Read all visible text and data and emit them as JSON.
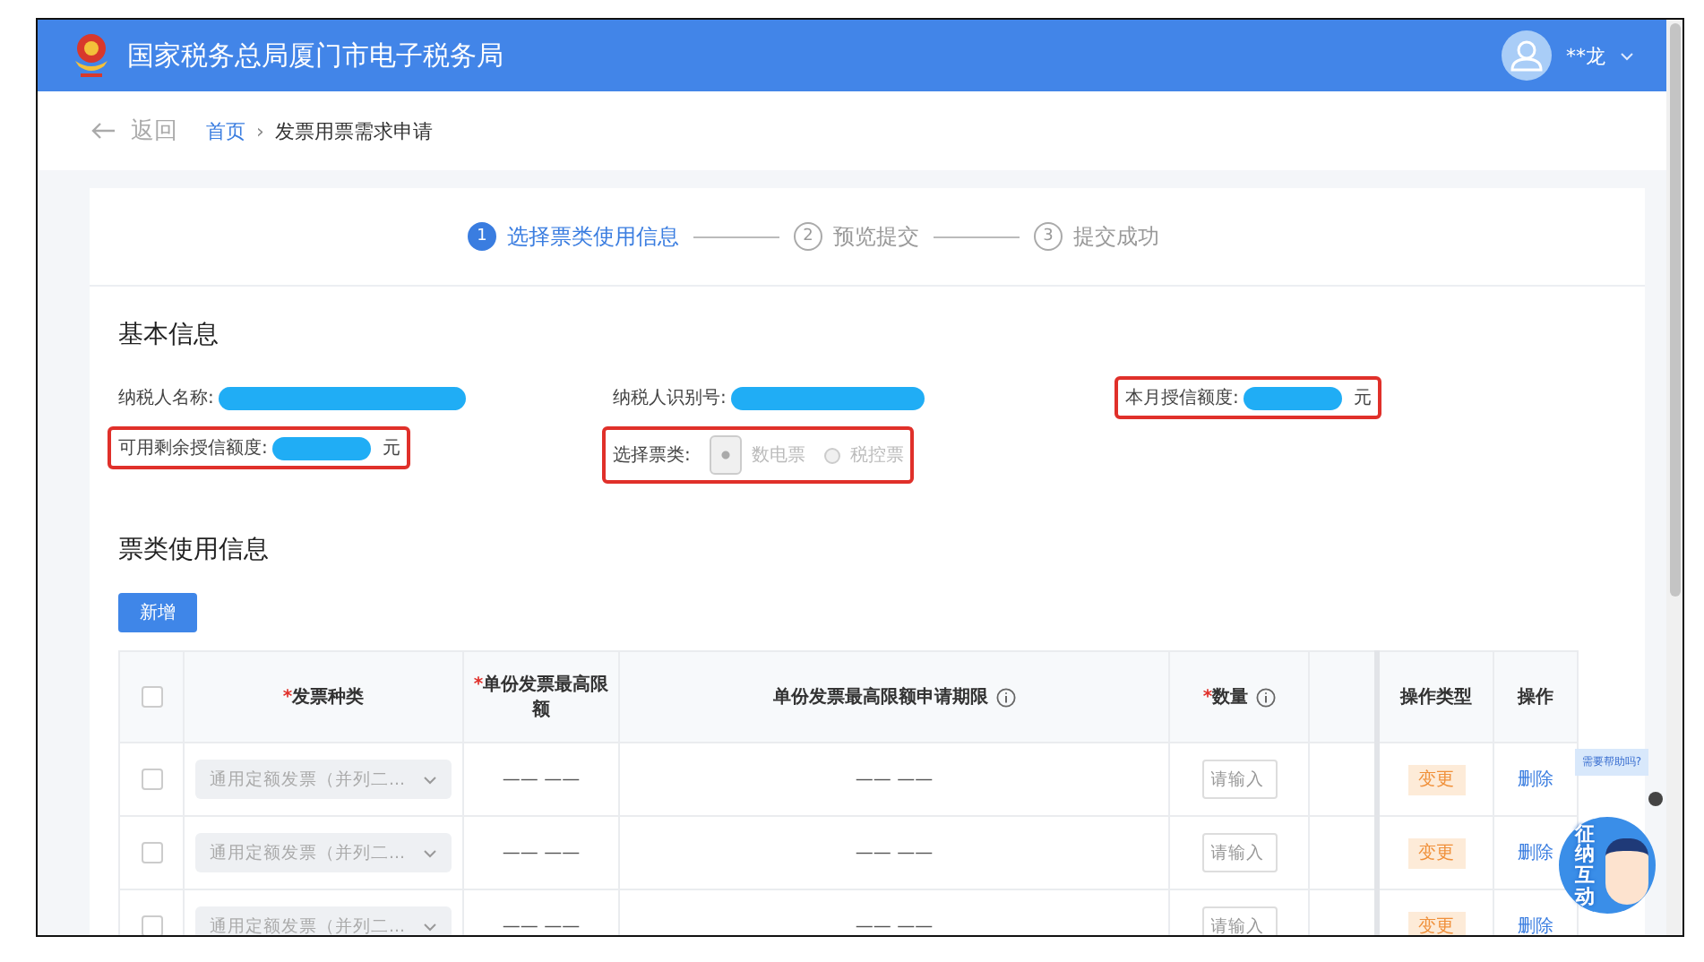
{
  "header": {
    "title": "国家税务总局厦门市电子税务局",
    "user_name": "**龙"
  },
  "breadcrumb": {
    "back": "返回",
    "separator": "›",
    "items": [
      {
        "label": "首页",
        "kind": "link"
      },
      {
        "label": "发票用票需求申请",
        "kind": "current"
      }
    ]
  },
  "steps": [
    {
      "number": "1",
      "label": "选择票类使用信息",
      "selected": true
    },
    {
      "number": "2",
      "label": "预览提交",
      "selected": false
    },
    {
      "number": "3",
      "label": "提交成功",
      "selected": false
    }
  ],
  "basic_info": {
    "title": "基本信息",
    "fields": [
      {
        "kind": "redacted",
        "label": "纳税人名称:",
        "highlighted": false
      },
      {
        "kind": "redacted",
        "label": "纳税人识别号:",
        "highlighted": false
      },
      {
        "kind": "redacted",
        "label": "本月授信额度:",
        "suffix": "元",
        "highlighted": true
      },
      {
        "kind": "redacted",
        "label": "可用剩余授信额度:",
        "suffix": "元",
        "highlighted": true
      },
      {
        "kind": "radio",
        "label": "选择票类:",
        "highlighted": true,
        "disabled": true,
        "options": [
          {
            "label": "数电票",
            "selected": true
          },
          {
            "label": "税控票",
            "selected": false
          }
        ]
      }
    ]
  },
  "usage": {
    "title": "票类使用信息",
    "add_button": "新增",
    "required_mark": "*",
    "columns": [
      {
        "kind": "checkbox",
        "checked": false
      },
      {
        "kind": "text",
        "label": "发票种类",
        "required": true,
        "info": false
      },
      {
        "kind": "text",
        "label": "单份发票最高限额",
        "required": true,
        "info": false
      },
      {
        "kind": "text",
        "label": "单份发票最高限额申请期限",
        "required": false,
        "info": true
      },
      {
        "kind": "text",
        "label": "数量",
        "required": true,
        "info": true
      },
      {
        "kind": "blank"
      },
      {
        "kind": "text",
        "label": "操作类型",
        "required": false
      },
      {
        "kind": "text",
        "label": "操作",
        "required": false
      }
    ],
    "rows": [
      {
        "checked": false,
        "invoice_type": "通用定额发票（并列二...",
        "limit": "—— ——",
        "period": "—— ——",
        "quantity_placeholder": "请输入",
        "op_type": "变更",
        "action": "删除"
      },
      {
        "checked": false,
        "invoice_type": "通用定额发票（并列二...",
        "limit": "—— ——",
        "period": "—— ——",
        "quantity_placeholder": "请输入",
        "op_type": "变更",
        "action": "删除"
      },
      {
        "checked": false,
        "invoice_type": "通用定额发票（并列二...",
        "limit": "—— ——",
        "period": "—— ——",
        "quantity_placeholder": "请输入",
        "op_type": "变更",
        "action": "删除"
      }
    ]
  },
  "helper": {
    "bubble": "需要帮助吗?",
    "label": "征纳互动"
  }
}
